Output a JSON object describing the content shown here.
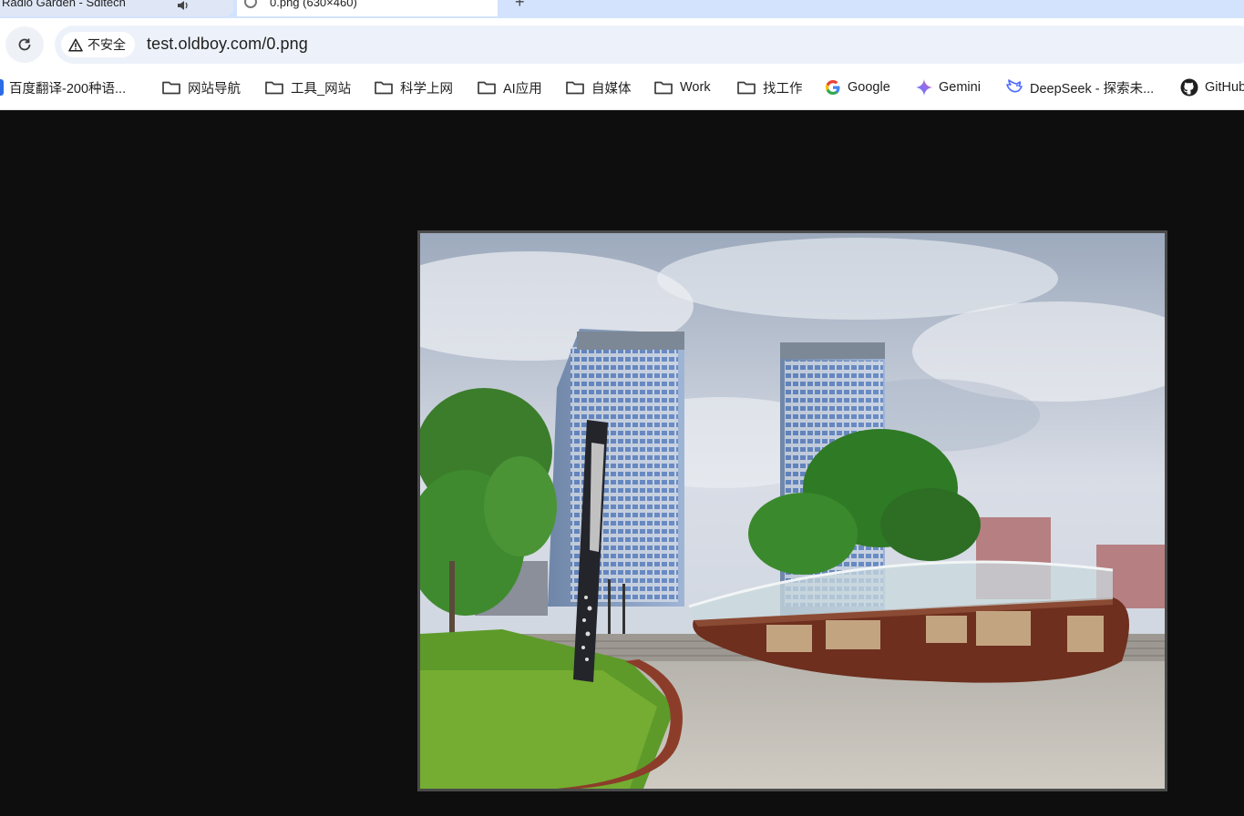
{
  "tabs": [
    {
      "title": "Radio Garden - Sdltech",
      "active": false,
      "audio_icon": "speaker-icon"
    },
    {
      "title": "0.png (630×460)",
      "active": true,
      "favicon": "globe-icon"
    }
  ],
  "toolbar": {
    "reload_icon": "reload-icon",
    "security_label": "不安全",
    "security_icon": "warning-triangle-icon",
    "url": "test.oldboy.com/0.png"
  },
  "bookmarks": [
    {
      "label": "百度翻译-200种语...",
      "icon": "baidu-icon"
    },
    {
      "label": "网站导航",
      "icon": "folder-icon"
    },
    {
      "label": "工具_网站",
      "icon": "folder-icon"
    },
    {
      "label": "科学上网",
      "icon": "folder-icon"
    },
    {
      "label": "AI应用",
      "icon": "folder-icon"
    },
    {
      "label": "自媒体",
      "icon": "folder-icon"
    },
    {
      "label": "Work",
      "icon": "folder-icon"
    },
    {
      "label": "找工作",
      "icon": "folder-icon"
    },
    {
      "label": "Google",
      "icon": "google-icon"
    },
    {
      "label": "Gemini",
      "icon": "gemini-icon"
    },
    {
      "label": "DeepSeek - 探索未...",
      "icon": "deepseek-icon"
    },
    {
      "label": "GitHub",
      "icon": "github-icon"
    }
  ],
  "viewer": {
    "background": "#0e0e0e",
    "image_alt": "0.png"
  },
  "colors": {
    "tabstrip": "#d3e3fd",
    "omnibox": "#edf2fa",
    "page_background": "#0e0e0e"
  }
}
